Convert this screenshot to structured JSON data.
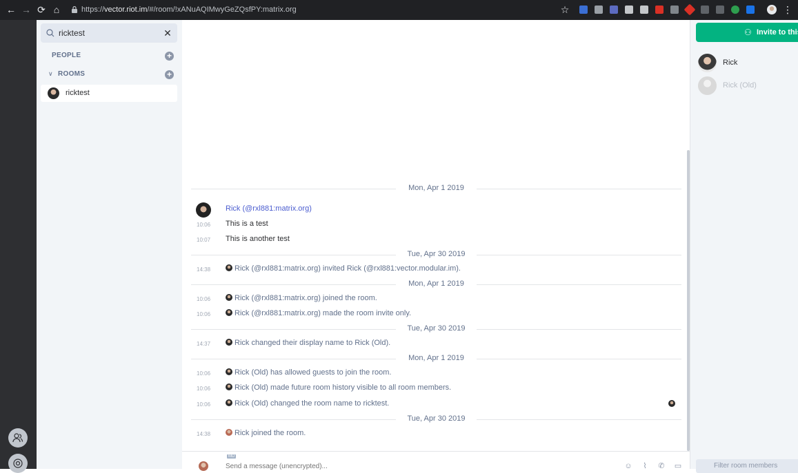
{
  "browser": {
    "url_prefix": "https://",
    "url_host": "vector.riot.im",
    "url_path": "/#/room/!xANuAQIMwyGeZQsfPY:matrix.org"
  },
  "colors": {
    "accent": "#03b381",
    "sender": "#4a5ccf",
    "sidebar_bg": "#f2f5f8",
    "rail_bg": "#2e2f32"
  },
  "search": {
    "value": "ricktest",
    "clear_label": "✕"
  },
  "sections": {
    "people": "PEOPLE",
    "rooms": "ROOMS"
  },
  "rooms": [
    {
      "name": "ricktest"
    }
  ],
  "timeline": {
    "dates": [
      "Mon, Apr 1 2019",
      "Tue, Apr 30 2019",
      "Mon, Apr 1 2019",
      "Tue, Apr 30 2019",
      "Mon, Apr 1 2019",
      "Tue, Apr 30 2019"
    ],
    "sender": "Rick (@rxl881:matrix.org)",
    "messages": [
      {
        "time": "10:06",
        "text": "This is a test"
      },
      {
        "time": "10:07",
        "text": "This is another test"
      }
    ],
    "events": [
      {
        "time": "14:38",
        "text": "Rick (@rxl881:matrix.org) invited Rick (@rxl881:vector.modular.im)."
      },
      {
        "time": "10:06",
        "text": "Rick (@rxl881:matrix.org) joined the room."
      },
      {
        "time": "10:06",
        "text": "Rick (@rxl881:matrix.org) made the room invite only."
      },
      {
        "time": "14:37",
        "text": "Rick changed their display name to Rick (Old)."
      },
      {
        "time": "10:06",
        "text": "Rick (Old) has allowed guests to join the room."
      },
      {
        "time": "10:06",
        "text": "Rick (Old) made future room history visible to all room members."
      },
      {
        "time": "10:06",
        "text": "Rick (Old) changed the room name to ricktest."
      },
      {
        "time": "14:38",
        "text": "Rick joined the room."
      }
    ]
  },
  "composer": {
    "md_badge": "MD",
    "placeholder": "Send a message (unencrypted)..."
  },
  "right_panel": {
    "invite_label": "Invite to this",
    "members": [
      {
        "name": "Rick"
      },
      {
        "name": "Rick (Old)"
      }
    ],
    "filter_placeholder": "Filter room members"
  }
}
